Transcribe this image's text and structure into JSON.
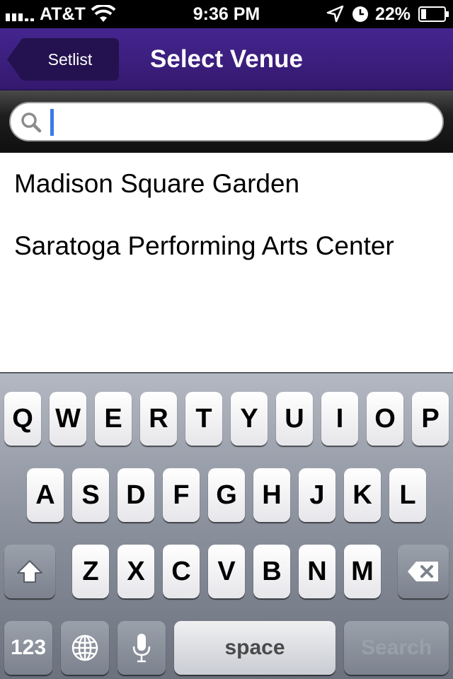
{
  "status_bar": {
    "carrier": "AT&T",
    "time": "9:36 PM",
    "battery_percent": "22%",
    "battery_level": 0.22,
    "icons": [
      "signal-icon",
      "wifi-icon",
      "location-arrow-icon",
      "alarm-icon",
      "battery-icon"
    ]
  },
  "nav": {
    "back_label": "Setlist",
    "title": "Select Venue"
  },
  "search": {
    "value": "",
    "placeholder": ""
  },
  "results": [
    "Madison Square Garden",
    "Saratoga Performing Arts Center"
  ],
  "keyboard": {
    "row1": [
      "Q",
      "W",
      "E",
      "R",
      "T",
      "Y",
      "U",
      "I",
      "O",
      "P"
    ],
    "row2": [
      "A",
      "S",
      "D",
      "F",
      "G",
      "H",
      "J",
      "K",
      "L"
    ],
    "row3": [
      "Z",
      "X",
      "C",
      "V",
      "B",
      "N",
      "M"
    ],
    "numbers_label": "123",
    "space_label": "space",
    "action_label": "Search",
    "icons": [
      "shift-icon",
      "backspace-icon",
      "globe-icon",
      "microphone-icon"
    ]
  },
  "colors": {
    "nav_bar": "#3d2283",
    "back_button": "#23124f",
    "caret": "#3d7ae8"
  }
}
